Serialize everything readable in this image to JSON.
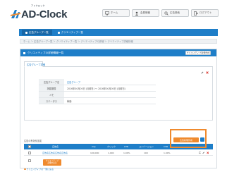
{
  "header": {
    "logo_text": "AD-Clock",
    "logo_sub": "アドクロック",
    "buttons": [
      {
        "icon": "monitor-icon",
        "label": "ホーム"
      },
      {
        "icon": "user-icon",
        "label": "会員情報"
      },
      {
        "icon": "search-icon",
        "label": "広告検索"
      },
      {
        "icon": "logout-icon",
        "label": "ログアウト"
      }
    ]
  },
  "tabs": [
    {
      "label": "広告グループ一覧",
      "active": true
    },
    {
      "label": "クリエイティブ一覧",
      "active": false
    }
  ],
  "breadcrumb": "ホーム ＞ 広告グループ一覧 ＞ クリエイティブ一覧 ＞ クリエイティブの詳細 ＞ クリエイティブ詳細情報",
  "panel": {
    "title": "クリエイティブの詳細情報一覧",
    "head_button": "クリエイティブ新規作成",
    "sub_tab": "広告グループ詳細",
    "info_rows": [
      {
        "label": "広告グループ名",
        "value": "広告グループ",
        "link": true
      },
      {
        "label": "掲載期間",
        "value": "2016年00月00日 (月曜日) ～ 2016年00月00日 (月曜日)",
        "link": false
      },
      {
        "label": "メモ",
        "value": "",
        "link": false
      },
      {
        "label": "ステータス",
        "value": "稼働",
        "link": false
      }
    ],
    "orange_button": "広告新規作成",
    "list_label": "広告の有効化設定",
    "table": {
      "headers": [
        "広告名",
        "imp",
        "クリック",
        "CTR",
        "コンバージョン",
        "CVR"
      ],
      "row": {
        "name": "広告名広告名広告名広告名",
        "imp": "100,000",
        "click": "1,000",
        "ctr": "1.00%",
        "cv": "100",
        "cvr": "1.00%"
      },
      "image_button": "クリエイティブ\n画像を表示"
    },
    "footer_link": "クリエイティブの一覧に戻る"
  },
  "colors": {
    "accent": "#1e7ec8",
    "orange": "#ef8a2e"
  }
}
